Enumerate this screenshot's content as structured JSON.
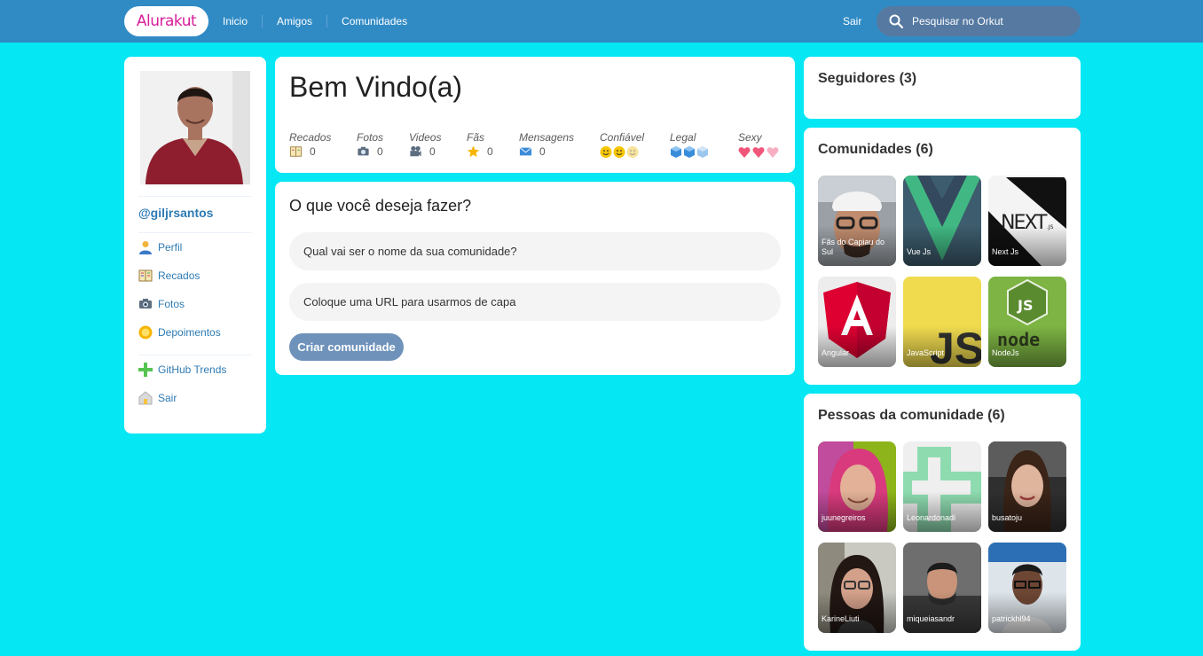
{
  "header": {
    "logo": "Alurakut",
    "nav": [
      "Inicio",
      "Amigos",
      "Comunidades"
    ],
    "logout": "Sair",
    "search_label": "Pesquisar no Orkut"
  },
  "profile": {
    "username": "@giljrsantos",
    "menu": [
      {
        "label": "Perfil",
        "icon": "user-icon"
      },
      {
        "label": "Recados",
        "icon": "book-icon"
      },
      {
        "label": "Fotos",
        "icon": "camera-icon"
      },
      {
        "label": "Depoimentos",
        "icon": "sun-icon"
      },
      {
        "label": "GitHub Trends",
        "icon": "plus-icon"
      },
      {
        "label": "Sair",
        "icon": "logout-icon"
      }
    ]
  },
  "welcome": {
    "title": "Bem Vindo(a)",
    "stats": [
      {
        "label": "Recados",
        "value": "0",
        "icon": "book-icon"
      },
      {
        "label": "Fotos",
        "value": "0",
        "icon": "camera-icon"
      },
      {
        "label": "Videos",
        "value": "0",
        "icon": "video-camera-icon"
      },
      {
        "label": "Fãs",
        "value": "0",
        "icon": "star-icon"
      },
      {
        "label": "Mensagens",
        "value": "0",
        "icon": "envelope-icon"
      },
      {
        "label": "Confiável",
        "icon": "smiley-icon"
      },
      {
        "label": "Legal",
        "icon": "ice-cube-icon"
      },
      {
        "label": "Sexy",
        "icon": "heart-icon"
      }
    ]
  },
  "form": {
    "title": "O que você deseja fazer?",
    "name_placeholder": "Qual vai ser o nome da sua comunidade?",
    "url_placeholder": "Coloque uma URL para usarmos de capa",
    "submit": "Criar comunidade"
  },
  "followers": {
    "title": "Seguidores (3)"
  },
  "communities": {
    "title": "Comunidades (6)",
    "items": [
      "Fãs do Capiau do Sul",
      "Vue Js",
      "Next Js",
      "Angular",
      "JavaScript",
      "NodeJs"
    ]
  },
  "people": {
    "title": "Pessoas da comunidade (6)",
    "items": [
      "juunegreiros",
      "Leonardonadi",
      "busatoju",
      "KarineLiuti",
      "miqueiasandr",
      "patrickhl94"
    ]
  },
  "colors": {
    "background": "#05E7F3",
    "topbar": "#308BC5",
    "logo_text": "#D81D99",
    "link": "#2E7BB4",
    "button": "#6F92BB"
  }
}
